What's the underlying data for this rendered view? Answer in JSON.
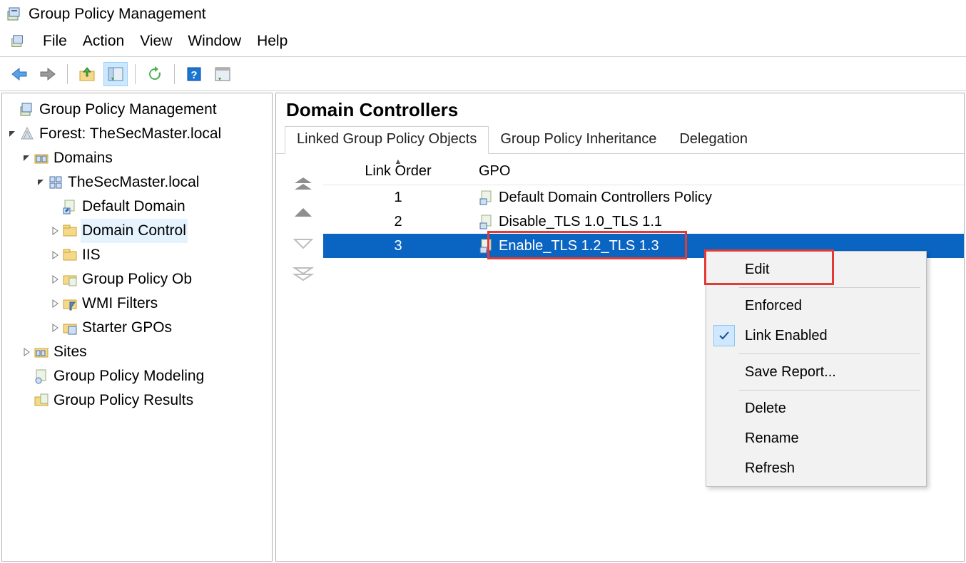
{
  "app": {
    "title": "Group Policy Management"
  },
  "menu": {
    "file": "File",
    "action": "Action",
    "view": "View",
    "window": "Window",
    "help": "Help"
  },
  "tree": {
    "root": "Group Policy Management",
    "forest": "Forest: TheSecMaster.local",
    "domains": "Domains",
    "domain": "TheSecMaster.local",
    "default_domain": "Default Domain",
    "domain_controllers": "Domain Control",
    "iis": "IIS",
    "gpo_objects": "Group Policy Ob",
    "wmi_filters": "WMI Filters",
    "starter_gpos": "Starter GPOs",
    "sites": "Sites",
    "modeling": "Group Policy Modeling",
    "results": "Group Policy Results"
  },
  "detail": {
    "heading": "Domain Controllers",
    "tabs": {
      "linked": "Linked Group Policy Objects",
      "inheritance": "Group Policy Inheritance",
      "delegation": "Delegation"
    },
    "columns": {
      "link_order": "Link Order",
      "gpo": "GPO"
    },
    "rows": [
      {
        "order": "1",
        "name": "Default Domain Controllers Policy"
      },
      {
        "order": "2",
        "name": "Disable_TLS 1.0_TLS 1.1"
      },
      {
        "order": "3",
        "name": "Enable_TLS 1.2_TLS 1.3"
      }
    ]
  },
  "context_menu": {
    "edit": "Edit",
    "enforced": "Enforced",
    "link_enabled": "Link Enabled",
    "save_report": "Save Report...",
    "delete": "Delete",
    "rename": "Rename",
    "refresh": "Refresh"
  }
}
